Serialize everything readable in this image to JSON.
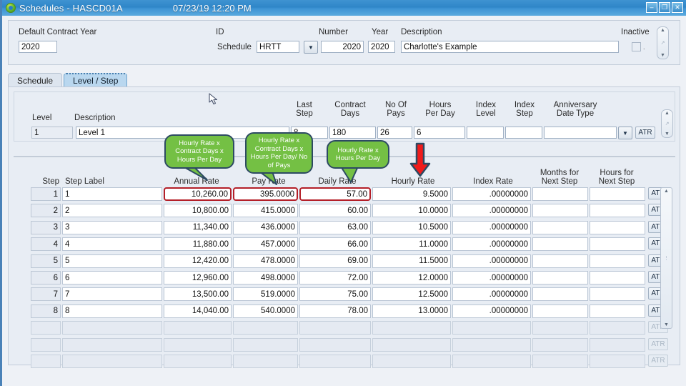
{
  "window": {
    "title": "Schedules - HASCD01A",
    "datetime": "07/23/19  12:20 PM",
    "icon": "application-icon",
    "minimize": "–",
    "maximize": "❐",
    "close": "✕"
  },
  "header": {
    "default_contract_year_label": "Default Contract Year",
    "default_contract_year_value": "2020",
    "schedule_label": "Schedule",
    "id_label": "ID",
    "id_value": "HRTT",
    "number_label": "Number",
    "number_value": "2020",
    "year_label": "Year",
    "year_value": "2020",
    "description_label": "Description",
    "description_value": "Charlotte's Example",
    "inactive_label": "Inactive",
    "inactive_checked": false
  },
  "tabs": [
    {
      "label": "Schedule",
      "active": false
    },
    {
      "label": "Level / Step",
      "active": true
    }
  ],
  "level_section": {
    "headers": [
      "Level",
      "Description",
      "Last\nStep",
      "Contract\nDays",
      "No Of\nPays",
      "Hours\nPer Day",
      "Index\nLevel",
      "Index\nStep",
      "Anniversary\nDate Type"
    ],
    "values": {
      "level": "1",
      "description": "Level 1",
      "last_step": "8",
      "contract_days": "180",
      "no_of_pays": "26",
      "hours_per_day": "6",
      "index_level": "",
      "index_step": "",
      "anniversary_date_type": ""
    },
    "atr_label": "ATR"
  },
  "callouts": [
    {
      "id": "annual-rate-formula",
      "text": "Hourly Rate x Contract Days x Hours Per Day"
    },
    {
      "id": "pay-rate-formula",
      "text": "Hourly Rate x Contract Days x Hours Per Day/ No of Pays"
    },
    {
      "id": "daily-rate-formula",
      "text": "Hourly Rate x Hours Per Day"
    }
  ],
  "annotation": {
    "red_arrow_target": "Hourly Rate",
    "red_arrow_color": "#f01b1b",
    "highlight_color": "#b41f28",
    "callout_fill": "#74c044",
    "callout_stroke": "#2d4a63"
  },
  "grid": {
    "columns": [
      "Step",
      "Step Label",
      "Annual Rate",
      "Pay Rate",
      "Daily Rate",
      "Hourly Rate",
      "Index Rate",
      "Months for\nNext Step",
      "Hours for\nNext Step"
    ],
    "atr_label": "ATR",
    "rows": [
      {
        "step": "1",
        "step_label": "1",
        "annual_rate": "10,260.00",
        "pay_rate": "395.0000",
        "daily_rate": "57.00",
        "hourly_rate": "9.5000",
        "index_rate": ".00000000",
        "months_next": "",
        "hours_next": ""
      },
      {
        "step": "2",
        "step_label": "2",
        "annual_rate": "10,800.00",
        "pay_rate": "415.0000",
        "daily_rate": "60.00",
        "hourly_rate": "10.0000",
        "index_rate": ".00000000",
        "months_next": "",
        "hours_next": ""
      },
      {
        "step": "3",
        "step_label": "3",
        "annual_rate": "11,340.00",
        "pay_rate": "436.0000",
        "daily_rate": "63.00",
        "hourly_rate": "10.5000",
        "index_rate": ".00000000",
        "months_next": "",
        "hours_next": ""
      },
      {
        "step": "4",
        "step_label": "4",
        "annual_rate": "11,880.00",
        "pay_rate": "457.0000",
        "daily_rate": "66.00",
        "hourly_rate": "11.0000",
        "index_rate": ".00000000",
        "months_next": "",
        "hours_next": ""
      },
      {
        "step": "5",
        "step_label": "5",
        "annual_rate": "12,420.00",
        "pay_rate": "478.0000",
        "daily_rate": "69.00",
        "hourly_rate": "11.5000",
        "index_rate": ".00000000",
        "months_next": "",
        "hours_next": ""
      },
      {
        "step": "6",
        "step_label": "6",
        "annual_rate": "12,960.00",
        "pay_rate": "498.0000",
        "daily_rate": "72.00",
        "hourly_rate": "12.0000",
        "index_rate": ".00000000",
        "months_next": "",
        "hours_next": ""
      },
      {
        "step": "7",
        "step_label": "7",
        "annual_rate": "13,500.00",
        "pay_rate": "519.0000",
        "daily_rate": "75.00",
        "hourly_rate": "12.5000",
        "index_rate": ".00000000",
        "months_next": "",
        "hours_next": ""
      },
      {
        "step": "8",
        "step_label": "8",
        "annual_rate": "14,040.00",
        "pay_rate": "540.0000",
        "daily_rate": "78.00",
        "hourly_rate": "13.0000",
        "index_rate": ".00000000",
        "months_next": "",
        "hours_next": ""
      }
    ],
    "empty_rows": 3,
    "highlighted_cells": [
      "annual_rate",
      "pay_rate",
      "daily_rate"
    ],
    "highlighted_row": 0
  }
}
